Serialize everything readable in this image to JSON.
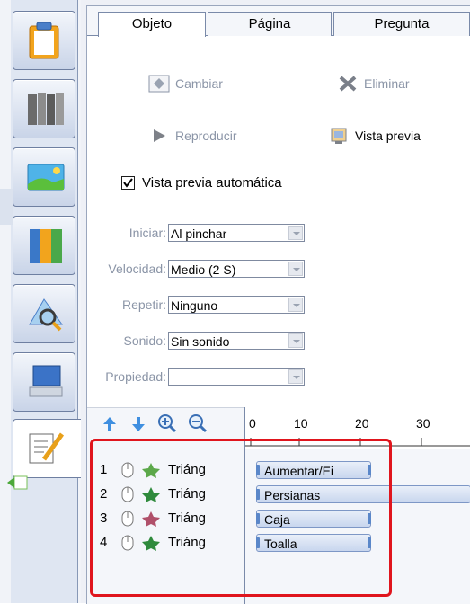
{
  "tabs": [
    {
      "label": "Objeto"
    },
    {
      "label": "Página"
    },
    {
      "label": "Pregunta"
    }
  ],
  "toolbar": {
    "change_label": "Cambiar",
    "delete_label": "Eliminar",
    "play_label": "Reproducir",
    "preview_label": "Vista previa"
  },
  "auto_preview": {
    "label": "Vista previa automática",
    "checked": true
  },
  "fields": {
    "start": {
      "label": "Iniciar:",
      "value": "Al pinchar"
    },
    "speed": {
      "label": "Velocidad:",
      "value": "Medio (2 S)"
    },
    "repeat": {
      "label": "Repetir:",
      "value": "Ninguno"
    },
    "sound": {
      "label": "Sonido:",
      "value": "Sin sonido"
    },
    "property": {
      "label": "Propiedad:",
      "value": ""
    }
  },
  "ruler": {
    "ticks": [
      "0",
      "10",
      "20",
      "30"
    ]
  },
  "animations": [
    {
      "index": "1",
      "object": "Triáng",
      "effect": "Aumentar/Ei"
    },
    {
      "index": "2",
      "object": "Triáng",
      "effect": "Persianas"
    },
    {
      "index": "3",
      "object": "Triáng",
      "effect": "Caja"
    },
    {
      "index": "4",
      "object": "Triáng",
      "effect": "Toalla"
    }
  ],
  "colors": {
    "highlight_border": "#e0151d",
    "effect_bar": "#c8d6ee",
    "disabled_text": "#8b95a7"
  }
}
